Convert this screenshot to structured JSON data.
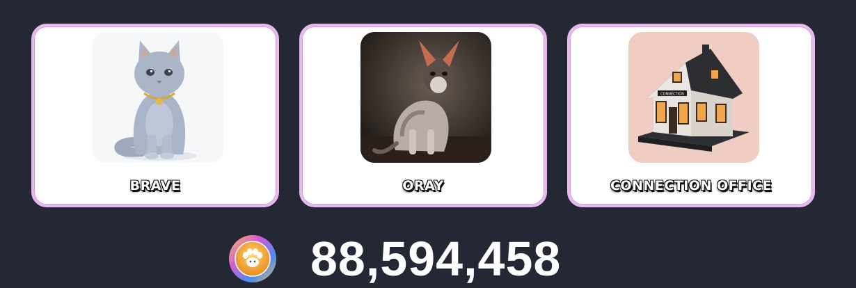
{
  "cards": [
    {
      "label": "BRAVE",
      "image": "grey-cat-icon"
    },
    {
      "label": "ORAY",
      "image": "sphynx-cat-icon"
    },
    {
      "label": "CONNECTION OFFICE",
      "image": "house-icon",
      "sign_text": "CONNECTION"
    }
  ],
  "balance": {
    "amount": "88,594,458",
    "icon": "paw-coin-icon"
  },
  "colors": {
    "background": "#232834",
    "card_border": "#e8b8ef",
    "card_fill": "#ffffff",
    "text": "#ffffff"
  }
}
